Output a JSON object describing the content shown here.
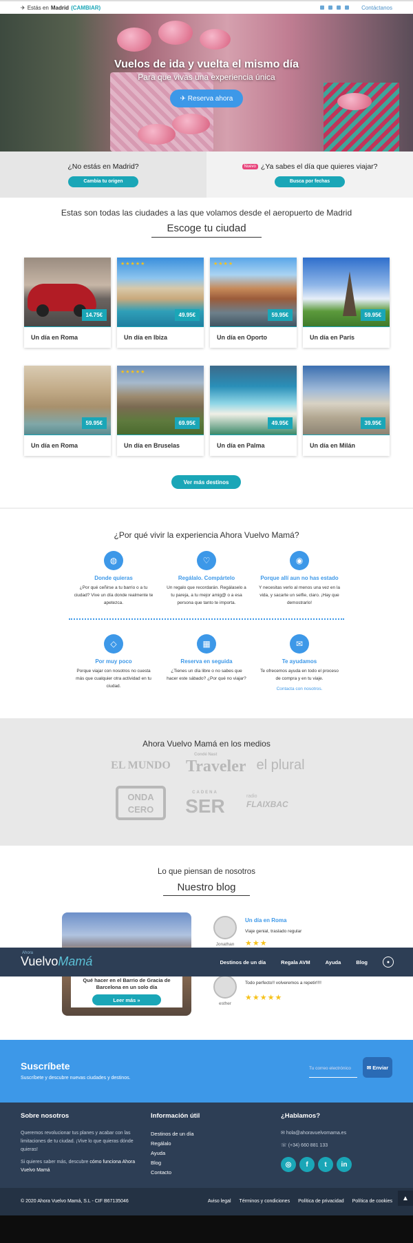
{
  "topbar": {
    "location_prefix": "Estás en",
    "city": "Madrid",
    "change": "(CAMBIAR)",
    "contact": "Contáctanos"
  },
  "hero": {
    "title": "Vuelos de ida y vuelta el mismo día",
    "subtitle": "Para que vivas una experiencia única",
    "cta": "Reserva ahora"
  },
  "split": {
    "left_title": "¿No estás en Madrid?",
    "left_button": "Cambia tu origen",
    "right_badge": "Nuevo",
    "right_title": "¿Ya sabes el día que quieres viajar?",
    "right_button": "Busca por fechas"
  },
  "cities": {
    "heading": "Estas son todas las ciudades a las que volamos desde el aeropuerto de Madrid",
    "subheading": "Escoge tu ciudad",
    "cards": [
      {
        "name": "Un día en Roma",
        "price": "14.75€"
      },
      {
        "name": "Un día en Ibiza",
        "price": "49.95€"
      },
      {
        "name": "Un día en Oporto",
        "price": "59.95€"
      },
      {
        "name": "Un día en París",
        "price": "59.95€"
      },
      {
        "name": "Un día en Roma",
        "price": "59.95€"
      },
      {
        "name": "Un día en Bruselas",
        "price": "69.95€"
      },
      {
        "name": "Un día en Palma",
        "price": "49.95€"
      },
      {
        "name": "Un día en Milán",
        "price": "39.95€"
      }
    ],
    "more": "Ver más destinos"
  },
  "why": {
    "title": "¿Por qué vivir la experiencia Ahora Vuelvo Mamá?",
    "features": [
      {
        "icon": "globe-icon",
        "title": "Donde quieras",
        "text": "¿Por qué ceñirse a tu barrio o a tu ciudad? Vive un día donde realmente te apetezca."
      },
      {
        "icon": "heart-icon",
        "title": "Regálalo. Compártelo",
        "text": "Un regalo que recordarán. Regálaselo a tu pareja, a tu mejor amig@ o a esa persona que tanto te importa."
      },
      {
        "icon": "camera-icon",
        "title": "Porque allí aun no has estado",
        "text": "Y necesitas verlo al menos una vez en la vida, y sacarte un selfie, claro. ¡Hay que demostrarlo!"
      },
      {
        "icon": "ticket-icon",
        "title": "Por muy poco",
        "text": "Porque viajar con nosotros no cuesta más que cualquier otra actividad en tu ciudad."
      },
      {
        "icon": "calendar-icon",
        "title": "Reserva en seguida",
        "text": "¿Tienes un día libre o no sabes que hacer este sábado? ¿Por qué no viajar?"
      },
      {
        "icon": "chat-icon",
        "title": "Te ayudamos",
        "text": "Te ofrecemos ayuda en todo el proceso de compra y en tu viaje.",
        "link": "Contacta con nosotros."
      }
    ]
  },
  "media": {
    "title": "Ahora Vuelvo Mamá en los medios",
    "logos": [
      "EL MUNDO",
      "Condé Nast",
      "Traveler",
      "el plural",
      "ONDA CERO",
      "CADENA",
      "SER",
      "radio",
      "FLAIXBAC"
    ]
  },
  "blog": {
    "heading": "Lo que piensan de nosotros",
    "subheading": "Nuestro blog",
    "post_title": "Qué hacer en el Barrio de Gracia de Barcelona en un solo día",
    "read_more": "Leer más »",
    "reviews": [
      {
        "title": "Un día en Roma",
        "text": "Viaje genial, traslado regular",
        "stars": "★★★",
        "author": "Jonathan"
      },
      {
        "title": "",
        "text": "Todo perfecto!! volveremos a repetir!!!!",
        "stars": "★★★★★",
        "author": "esther"
      }
    ]
  },
  "navbar": {
    "logo_small": "Ahora",
    "logo_a": "Vuelvo",
    "logo_b": "Mamá",
    "items": [
      "Destinos de un día",
      "Regala AVM",
      "Ayuda",
      "Blog"
    ]
  },
  "subscribe": {
    "title": "Suscríbete",
    "text": "Suscríbete y descubre nuevas ciudades y destinos.",
    "placeholder": "Tu correo electrónico",
    "button": "Enviar"
  },
  "footer": {
    "about_title": "Sobre nosotros",
    "about_text": "Queremos revolucionar tus planes y acabar con las limitaciones de tu ciudad. ¡Vive lo que quieras dónde quieras!",
    "about_text2_prefix": "Si quieres saber más, descubre",
    "about_text2_link": "cómo funciona Ahora Vuelvo Mamá",
    "info_title": "Información útil",
    "info_links": [
      "Destinos de un día",
      "Regálalo",
      "Ayuda",
      "Blog",
      "Contacto"
    ],
    "talk_title": "¿Hablamos?",
    "email": "hola@ahoravuelvomama.es",
    "phone": "(+34) 660 881 133"
  },
  "bottom": {
    "copyright": "© 2020 Ahora Vuelvo Mamá, S.L - CIF B67135046",
    "links": [
      "Aviso legal",
      "Términos y condiciones",
      "Política de privacidad",
      "Política de cookies"
    ]
  },
  "colors": {
    "teal": "#1aa6b7",
    "blue": "#3d98e8",
    "navy": "#2d3e55"
  }
}
